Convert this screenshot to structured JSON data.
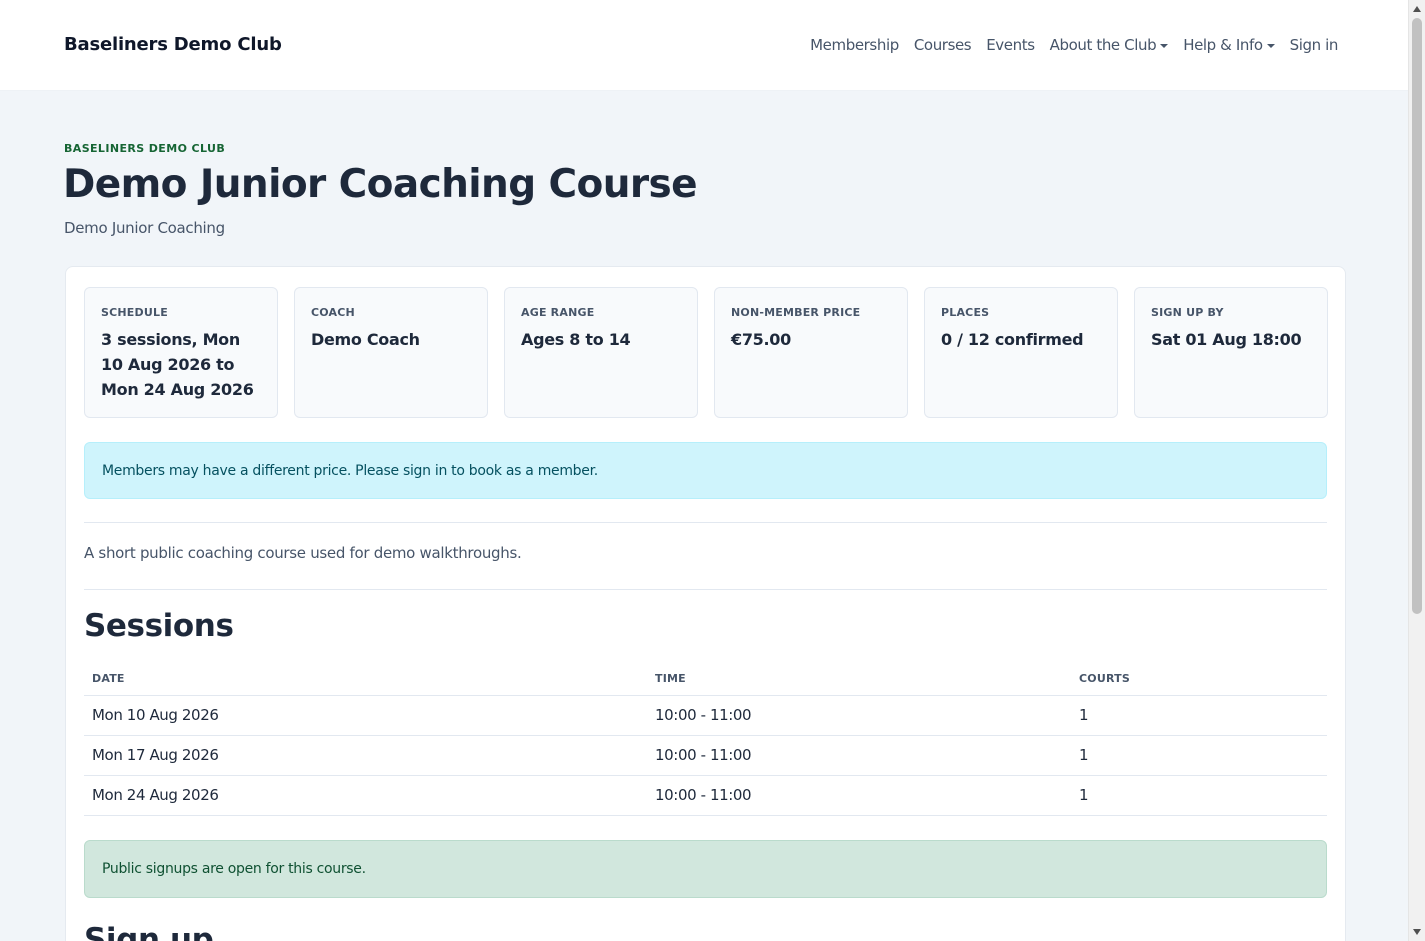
{
  "navbar": {
    "brand": "Baseliners Demo Club",
    "links": [
      {
        "label": "Membership",
        "dropdown": false
      },
      {
        "label": "Courses",
        "dropdown": false
      },
      {
        "label": "Events",
        "dropdown": false
      },
      {
        "label": "About the Club",
        "dropdown": true
      },
      {
        "label": "Help & Info",
        "dropdown": true
      },
      {
        "label": "Sign in",
        "dropdown": false
      }
    ]
  },
  "header": {
    "eyebrow": "BASELINERS DEMO CLUB",
    "title": "Demo Junior Coaching Course",
    "subtitle": "Demo Junior Coaching"
  },
  "stats": [
    {
      "label": "SCHEDULE",
      "value": "3 sessions, Mon 10 Aug 2026 to Mon 24 Aug 2026"
    },
    {
      "label": "COACH",
      "value": "Demo Coach"
    },
    {
      "label": "AGE RANGE",
      "value": "Ages 8 to 14"
    },
    {
      "label": "NON-MEMBER PRICE",
      "value": "€75.00"
    },
    {
      "label": "PLACES",
      "value": "0 / 12 confirmed"
    },
    {
      "label": "SIGN UP BY",
      "value": "Sat 01 Aug 18:00"
    }
  ],
  "member_notice": "Members may have a different price. Please sign in to book as a member.",
  "description": "A short public coaching course used for demo walkthroughs.",
  "sessions": {
    "heading": "Sessions",
    "columns": [
      "DATE",
      "TIME",
      "COURTS"
    ],
    "rows": [
      {
        "date": "Mon 10 Aug 2026",
        "time": "10:00 - 11:00",
        "courts": "1"
      },
      {
        "date": "Mon 17 Aug 2026",
        "time": "10:00 - 11:00",
        "courts": "1"
      },
      {
        "date": "Mon 24 Aug 2026",
        "time": "10:00 - 11:00",
        "courts": "1"
      }
    ]
  },
  "signup_status": "Public signups are open for this course.",
  "signup_heading": "Sign up"
}
